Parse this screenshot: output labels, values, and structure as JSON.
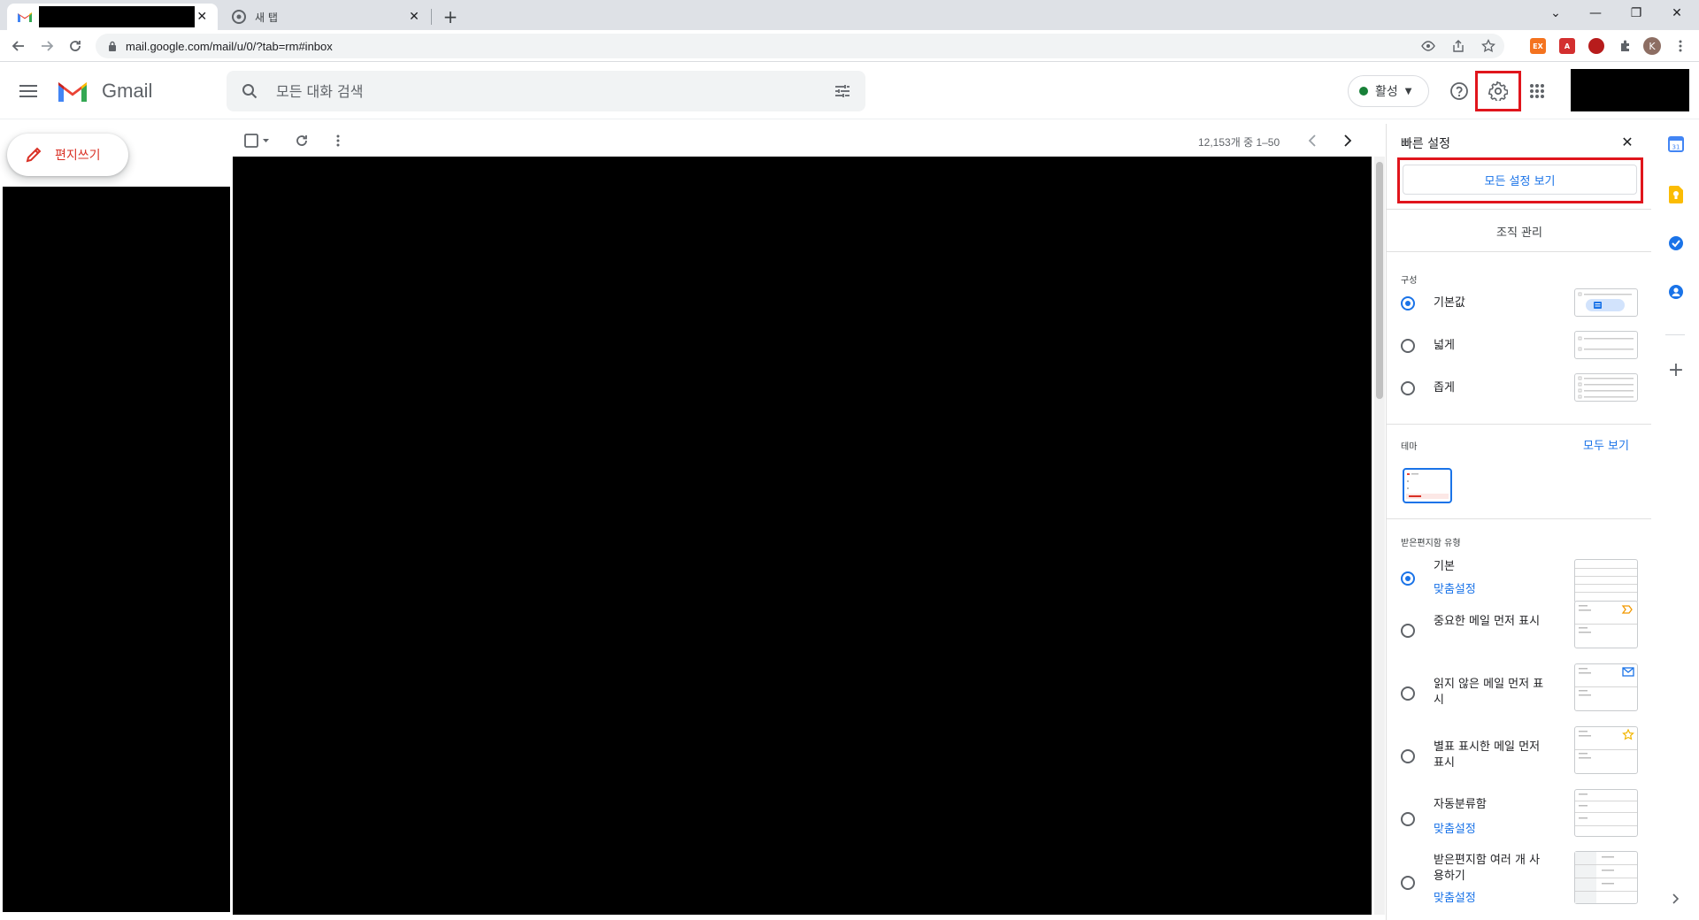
{
  "browser": {
    "tabs": [
      {
        "title": "",
        "active": true
      },
      {
        "title": "새 탭",
        "active": false
      }
    ],
    "url": "mail.google.com/mail/u/0/?tab=rm#inbox",
    "profile_initial": "K",
    "extensions": [
      "ex",
      "pdf",
      "shield",
      "puzzle"
    ]
  },
  "header": {
    "app_name": "Gmail",
    "search_placeholder": "모든 대화 검색",
    "status_label": "활성",
    "status_color": "#188038"
  },
  "nav": {
    "compose_label": "편지쓰기"
  },
  "list": {
    "pager_text": "12,153개 중 1–50"
  },
  "quick_settings": {
    "title": "빠른 설정",
    "all_settings_label": "모든 설정 보기",
    "org_label": "조직 관리",
    "density_section": "구성",
    "density_options": [
      {
        "label": "기본값",
        "checked": true
      },
      {
        "label": "넓게",
        "checked": false
      },
      {
        "label": "좁게",
        "checked": false
      }
    ],
    "theme_section": "테마",
    "theme_view_all": "모두 보기",
    "inbox_section": "받은편지함 유형",
    "inbox_options": [
      {
        "label": "기본",
        "sub": "맞춤설정",
        "checked": true
      },
      {
        "label": "중요한 메일 먼저 표시",
        "checked": false
      },
      {
        "label": "읽지 않은 메일 먼저 표시",
        "checked": false
      },
      {
        "label": "별표 표시한 메일 먼저 표시",
        "checked": false
      },
      {
        "label": "자동분류함",
        "sub": "맞춤설정",
        "checked": false
      },
      {
        "label": "받은편지함 여러 개 사용하기",
        "sub": "맞춤설정",
        "checked": false
      }
    ]
  },
  "colors": {
    "accent": "#1a73e8",
    "highlight": "#e0151c",
    "compose_text": "#d93025"
  }
}
